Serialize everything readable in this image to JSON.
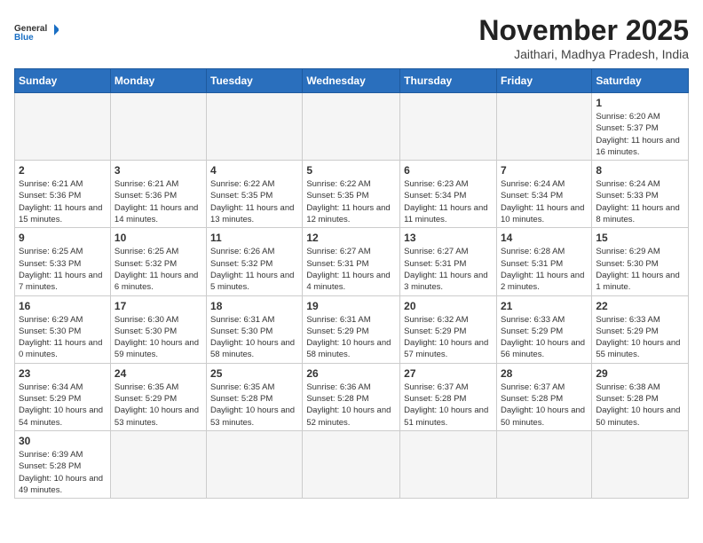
{
  "logo": {
    "text_general": "General",
    "text_blue": "Blue"
  },
  "header": {
    "month": "November 2025",
    "location": "Jaithari, Madhya Pradesh, India"
  },
  "weekdays": [
    "Sunday",
    "Monday",
    "Tuesday",
    "Wednesday",
    "Thursday",
    "Friday",
    "Saturday"
  ],
  "days": {
    "1": {
      "sunrise": "6:20 AM",
      "sunset": "5:37 PM",
      "daylight": "11 hours and 16 minutes."
    },
    "2": {
      "sunrise": "6:21 AM",
      "sunset": "5:36 PM",
      "daylight": "11 hours and 15 minutes."
    },
    "3": {
      "sunrise": "6:21 AM",
      "sunset": "5:36 PM",
      "daylight": "11 hours and 14 minutes."
    },
    "4": {
      "sunrise": "6:22 AM",
      "sunset": "5:35 PM",
      "daylight": "11 hours and 13 minutes."
    },
    "5": {
      "sunrise": "6:22 AM",
      "sunset": "5:35 PM",
      "daylight": "11 hours and 12 minutes."
    },
    "6": {
      "sunrise": "6:23 AM",
      "sunset": "5:34 PM",
      "daylight": "11 hours and 11 minutes."
    },
    "7": {
      "sunrise": "6:24 AM",
      "sunset": "5:34 PM",
      "daylight": "11 hours and 10 minutes."
    },
    "8": {
      "sunrise": "6:24 AM",
      "sunset": "5:33 PM",
      "daylight": "11 hours and 8 minutes."
    },
    "9": {
      "sunrise": "6:25 AM",
      "sunset": "5:33 PM",
      "daylight": "11 hours and 7 minutes."
    },
    "10": {
      "sunrise": "6:25 AM",
      "sunset": "5:32 PM",
      "daylight": "11 hours and 6 minutes."
    },
    "11": {
      "sunrise": "6:26 AM",
      "sunset": "5:32 PM",
      "daylight": "11 hours and 5 minutes."
    },
    "12": {
      "sunrise": "6:27 AM",
      "sunset": "5:31 PM",
      "daylight": "11 hours and 4 minutes."
    },
    "13": {
      "sunrise": "6:27 AM",
      "sunset": "5:31 PM",
      "daylight": "11 hours and 3 minutes."
    },
    "14": {
      "sunrise": "6:28 AM",
      "sunset": "5:31 PM",
      "daylight": "11 hours and 2 minutes."
    },
    "15": {
      "sunrise": "6:29 AM",
      "sunset": "5:30 PM",
      "daylight": "11 hours and 1 minute."
    },
    "16": {
      "sunrise": "6:29 AM",
      "sunset": "5:30 PM",
      "daylight": "11 hours and 0 minutes."
    },
    "17": {
      "sunrise": "6:30 AM",
      "sunset": "5:30 PM",
      "daylight": "10 hours and 59 minutes."
    },
    "18": {
      "sunrise": "6:31 AM",
      "sunset": "5:30 PM",
      "daylight": "10 hours and 58 minutes."
    },
    "19": {
      "sunrise": "6:31 AM",
      "sunset": "5:29 PM",
      "daylight": "10 hours and 58 minutes."
    },
    "20": {
      "sunrise": "6:32 AM",
      "sunset": "5:29 PM",
      "daylight": "10 hours and 57 minutes."
    },
    "21": {
      "sunrise": "6:33 AM",
      "sunset": "5:29 PM",
      "daylight": "10 hours and 56 minutes."
    },
    "22": {
      "sunrise": "6:33 AM",
      "sunset": "5:29 PM",
      "daylight": "10 hours and 55 minutes."
    },
    "23": {
      "sunrise": "6:34 AM",
      "sunset": "5:29 PM",
      "daylight": "10 hours and 54 minutes."
    },
    "24": {
      "sunrise": "6:35 AM",
      "sunset": "5:29 PM",
      "daylight": "10 hours and 53 minutes."
    },
    "25": {
      "sunrise": "6:35 AM",
      "sunset": "5:28 PM",
      "daylight": "10 hours and 53 minutes."
    },
    "26": {
      "sunrise": "6:36 AM",
      "sunset": "5:28 PM",
      "daylight": "10 hours and 52 minutes."
    },
    "27": {
      "sunrise": "6:37 AM",
      "sunset": "5:28 PM",
      "daylight": "10 hours and 51 minutes."
    },
    "28": {
      "sunrise": "6:37 AM",
      "sunset": "5:28 PM",
      "daylight": "10 hours and 50 minutes."
    },
    "29": {
      "sunrise": "6:38 AM",
      "sunset": "5:28 PM",
      "daylight": "10 hours and 50 minutes."
    },
    "30": {
      "sunrise": "6:39 AM",
      "sunset": "5:28 PM",
      "daylight": "10 hours and 49 minutes."
    }
  }
}
